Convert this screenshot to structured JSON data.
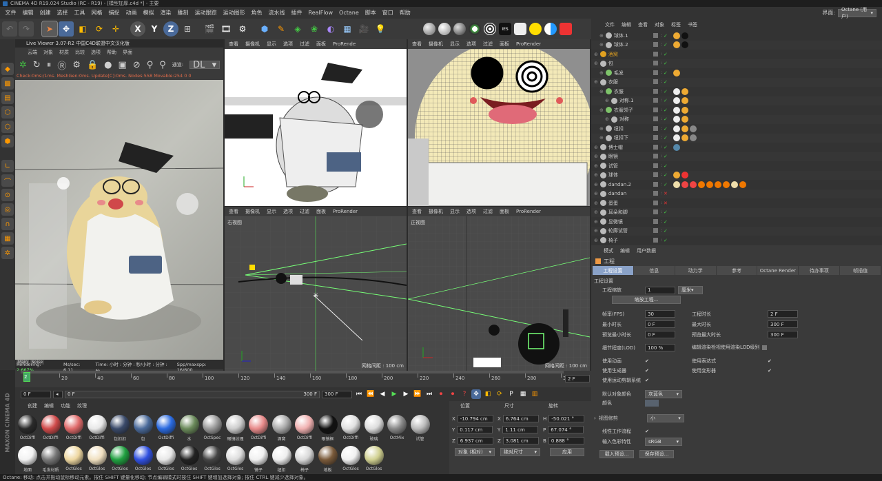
{
  "titlebar": {
    "app": "CINEMA 4D R19.024 Studio (RC - R19) - [模型加厚.c4d *] - 主要"
  },
  "menu": [
    "文件",
    "编辑",
    "创建",
    "选择",
    "工具",
    "网格",
    "捕捉",
    "动画",
    "模拟",
    "渲染",
    "雕刻",
    "运动跟踪",
    "运动图形",
    "角色",
    "流水线",
    "插件",
    "RealFlow",
    "Octane",
    "脚本",
    "窗口",
    "帮助"
  ],
  "layout": {
    "label": "界面:",
    "value": "Octane (用户)"
  },
  "live": {
    "title": "Live Viewer 3.07-R2 中国C4D联盟中文汉化版",
    "menu": [
      "云端",
      "对象",
      "材质",
      "比较",
      "选项",
      "帮助",
      "界面"
    ],
    "channel_label": "通道:",
    "channel_value": "DL",
    "status": "Check:0ms:/1ms. MeshGen:0ms. Update[C]:0ms. Nodes:558 Movable:254  0 0",
    "tab_main": "Main",
    "tab_noise": "Noise",
    "render_line_prefix": "Rendering: ",
    "render_pct": "2.667%",
    "render_ms": "Ms/sec: 6.11",
    "render_time": "Time: 小时 : 分钟 : 秒/小时 : 分钟 : 秒",
    "render_spp": "Spp/maxspp: 16/600"
  },
  "viewport_menu": [
    "查看",
    "摄像机",
    "显示",
    "选项",
    "过滤",
    "面板",
    "ProRender"
  ],
  "viewport_menu_tl": [
    "查看",
    "摄像机",
    "显示",
    "选项",
    "过滤",
    "面板",
    "ProRende"
  ],
  "vp_right": {
    "name": "右视图",
    "grid": "网格间距 : 100 cm"
  },
  "vp_front": {
    "name": "正视图",
    "grid": "网格间距 : 100 cm"
  },
  "objmgr": {
    "menu": [
      "文件",
      "编辑",
      "查看",
      "对象",
      "标签",
      "书签"
    ],
    "rows": [
      {
        "name": "球体.1",
        "color": "#bbb",
        "indent": 1
      },
      {
        "name": "球体.2",
        "color": "#bbb",
        "indent": 1
      },
      {
        "name": "酒窝",
        "color": "#e0a020",
        "indent": 0
      },
      {
        "name": "包",
        "color": "#bbb",
        "indent": 0
      },
      {
        "name": "毛发",
        "color": "#7ec36a",
        "indent": 1
      },
      {
        "name": "衣服",
        "color": "#bbb",
        "indent": 0
      },
      {
        "name": "衣服",
        "color": "#7ec36a",
        "indent": 1
      },
      {
        "name": "对称.1",
        "color": "#bbb",
        "indent": 2
      },
      {
        "name": "衣服领子",
        "color": "#7ec36a",
        "indent": 1
      },
      {
        "name": "对称",
        "color": "#bbb",
        "indent": 2
      },
      {
        "name": "纽扣",
        "color": "#bbb",
        "indent": 1
      },
      {
        "name": "纽扣下",
        "color": "#bbb",
        "indent": 1
      },
      {
        "name": "博士帽",
        "color": "#bbb",
        "indent": 0
      },
      {
        "name": "眼镜",
        "color": "#bbb",
        "indent": 0
      },
      {
        "name": "试管",
        "color": "#bbb",
        "indent": 0
      },
      {
        "name": "球体",
        "color": "#bbb",
        "indent": 0
      },
      {
        "name": "dandan.2",
        "color": "#bbb",
        "indent": 0
      },
      {
        "name": "dandan",
        "color": "#bbb",
        "indent": 0
      },
      {
        "name": "蛋蛋",
        "color": "#bbb",
        "indent": 0
      },
      {
        "name": "耳朵和脚",
        "color": "#bbb",
        "indent": 0
      },
      {
        "name": "显微镜",
        "color": "#bbb",
        "indent": 0
      },
      {
        "name": "轮廓试管",
        "color": "#bbb",
        "indent": 0
      },
      {
        "name": "椅子",
        "color": "#bbb",
        "indent": 0
      }
    ]
  },
  "attr": {
    "menu": [
      "模式",
      "编辑",
      "用户数据"
    ],
    "section": "工程",
    "tabs": [
      "工程设置",
      "信息",
      "动力学",
      "参考",
      "Octane Render",
      "待办事项",
      "帧插值"
    ],
    "group": "工程设置",
    "scale_label": "工程缩放",
    "scale_value": "1",
    "scale_unit": "厘米",
    "scale_btn": "缩放工程...",
    "fps_label": "帧率(FPS)",
    "fps": "30",
    "duration_label": "工程时长",
    "duration": "2 F",
    "min_label": "最小时长",
    "min": "0 F",
    "max_label": "最大时长",
    "max": "300 F",
    "pmin_label": "预览最小时长",
    "pmin": "0 F",
    "pmax_label": "预览最大时长",
    "pmax": "300 F",
    "lod_label": "细节程度(LOD)",
    "lod": "100 %",
    "lod_edit": "编辑渲染检视使用渲染LOD级别",
    "use_anim": "使用动画",
    "use_expr": "使用表达式",
    "use_gen": "使用生成器",
    "use_deform": "使用变形器",
    "use_motion": "使用运动剪辑系统",
    "defcolor_label": "默认对象颜色",
    "defcolor": "灰蓝色",
    "color_label": "颜色",
    "viewcorr_label": "视图修剪",
    "viewcorr": "小",
    "linear_label": "线性工作流程",
    "input_label": "输入色彩特性",
    "input": "sRGB",
    "load_btn": "载入预设...",
    "save_btn": "保存预设..."
  },
  "timeline": {
    "ticks": [
      "0",
      "20",
      "40",
      "60",
      "80",
      "100",
      "120",
      "140",
      "160",
      "180",
      "200",
      "220",
      "240",
      "260",
      "280",
      "300"
    ],
    "current": "2",
    "end": "2 F"
  },
  "transport": {
    "start": "0 F",
    "mid": "0 F",
    "range_end": "300 F",
    "end": "300 F"
  },
  "matmgr": {
    "menu": [
      "创建",
      "编辑",
      "功能",
      "纹理"
    ],
    "materials": [
      {
        "name": "OctDiffi",
        "color": "#2a2a2a"
      },
      {
        "name": "OctDiffi",
        "color": "#d04a4a"
      },
      {
        "name": "OctDiffi",
        "color": "#e06a6a"
      },
      {
        "name": "OctDiffi",
        "color": "#e8e8e8"
      },
      {
        "name": "包扣扣",
        "color": "#3a4a6a"
      },
      {
        "name": "包",
        "color": "#4a6a9a"
      },
      {
        "name": "OctDiffi",
        "color": "#2a6ae0"
      },
      {
        "name": "水",
        "color": "#6a8a5a"
      },
      {
        "name": "OctSpec",
        "color": "#999"
      },
      {
        "name": "眼镜纹理",
        "color": "#ccc"
      },
      {
        "name": "OctDiffi",
        "color": "#e88a8a"
      },
      {
        "name": "酒窝",
        "color": "#aaa"
      },
      {
        "name": "OctDiffi",
        "color": "#f0b0b0"
      },
      {
        "name": "眼镜框",
        "color": "#111"
      },
      {
        "name": "OctDiffi",
        "color": "#e0e0e0"
      },
      {
        "name": "玻璃",
        "color": "#ddd"
      },
      {
        "name": "OctMix",
        "color": "#888"
      },
      {
        "name": "试管",
        "color": "#bbb"
      },
      {
        "name": "地面",
        "color": "#f2f2f2"
      },
      {
        "name": "毛发材质",
        "color": "#777"
      },
      {
        "name": "OctGlos",
        "color": "#eed7a0"
      },
      {
        "name": "OctGlos",
        "color": "#f0e0c0"
      },
      {
        "name": "OctGlos",
        "color": "#20a040"
      },
      {
        "name": "OctGlos",
        "color": "#3050e0"
      },
      {
        "name": "OctGlos",
        "color": "#e8e8e8"
      },
      {
        "name": "OctGlos",
        "color": "#222"
      },
      {
        "name": "OctGlos",
        "color": "#444"
      },
      {
        "name": "OctGlos",
        "color": "#ddd"
      },
      {
        "name": "镜子",
        "color": "#f0f0f0"
      },
      {
        "name": "纽扣",
        "color": "#eee"
      },
      {
        "name": "椅子",
        "color": "#d8d8d8"
      },
      {
        "name": "地板",
        "color": "#7a5a3a"
      },
      {
        "name": "OctGlos",
        "color": "#f0f0f0"
      },
      {
        "name": "OctGlos",
        "color": "#d0d090"
      }
    ]
  },
  "coords": {
    "headers": [
      "位置",
      "尺寸",
      "旋转"
    ],
    "x": "-10.794 cm",
    "y": "0.117 cm",
    "z": "6.937 cm",
    "sx": "6.764 cm",
    "sy": "1.11 cm",
    "sz": "3.081 cm",
    "h": "-50.021 °",
    "p": "67.074 °",
    "b": "0.888 °",
    "mode": "对象 (相对)",
    "size_mode": "绝对尺寸",
    "apply": "应用"
  },
  "statusbar": "Octane:    移动: 点击并拖动鼠标移动元素。按住 SHIFT 键量化移动; 节点编辑模式时按住 SHIFT 键增加选择对象; 按住 CTRL 键减少选择对象。",
  "logo": "MAXON CINEMA 4D"
}
